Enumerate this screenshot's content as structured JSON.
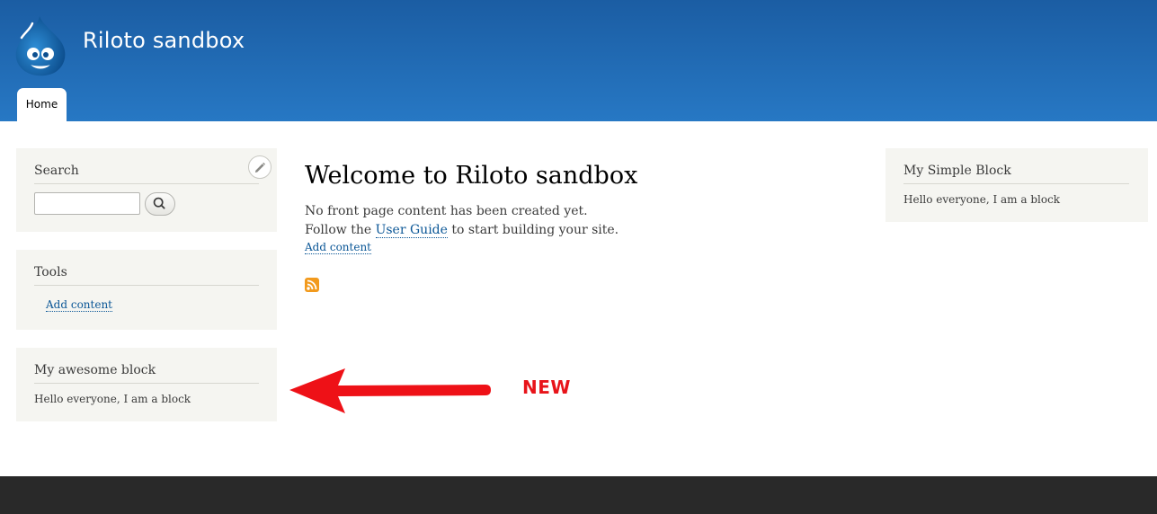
{
  "header": {
    "site_name": "Riloto sandbox",
    "logo_icon": "drupal-drop-icon",
    "background_colors": [
      "#1b5da3",
      "#2778c4"
    ]
  },
  "nav": {
    "tabs": [
      {
        "label": "Home",
        "active": true
      }
    ]
  },
  "sidebar_first": {
    "search_block": {
      "title": "Search",
      "input_value": "",
      "button_icon": "search-icon",
      "edit_icon": "pencil-icon"
    },
    "tools_block": {
      "title": "Tools",
      "links": [
        "Add content"
      ]
    },
    "awesome_block": {
      "title": "My awesome block",
      "body": "Hello everyone, I am a block"
    }
  },
  "main": {
    "title": "Welcome to Riloto sandbox",
    "line1": "No front page content has been created yet.",
    "line2_prefix": "Follow the ",
    "line2_link": "User Guide",
    "line2_suffix": " to start building your site.",
    "add_content_link": "Add content",
    "feed_icon": "rss-icon"
  },
  "sidebar_second": {
    "simple_block": {
      "title": "My Simple Block",
      "body": "Hello everyone, I am a block"
    }
  },
  "annotation": {
    "label": "NEW",
    "color": "#e8141a",
    "arrow_icon": "left-arrow-icon"
  },
  "footer": {
    "color": "#292929"
  }
}
